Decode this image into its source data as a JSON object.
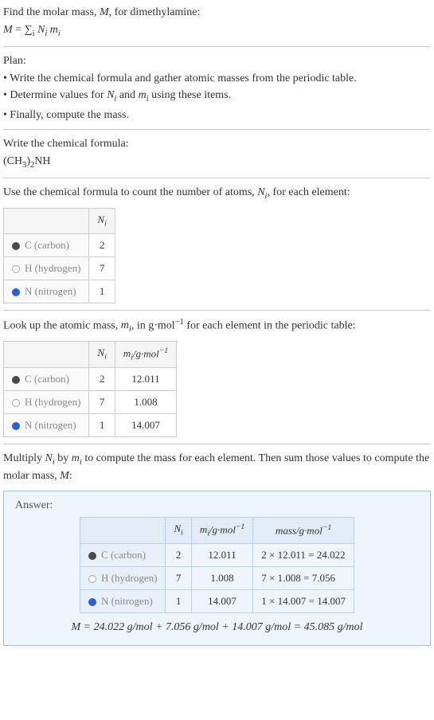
{
  "intro": {
    "line1": "Find the molar mass, M, for dimethylamine:",
    "formula": "M = Σᵢ Nᵢ mᵢ"
  },
  "plan": {
    "title": "Plan:",
    "b1": "• Write the chemical formula and gather atomic masses from the periodic table.",
    "b2": "• Determine values for Nᵢ and mᵢ using these items.",
    "b3": "• Finally, compute the mass."
  },
  "formula_section": {
    "line1": "Write the chemical formula:",
    "formula": "(CH₃)₂NH"
  },
  "count_section": {
    "intro": "Use the chemical formula to count the number of atoms, Nᵢ, for each element:",
    "header_ni": "Nᵢ",
    "rows": [
      {
        "dot": "carbon",
        "label": "C (carbon)",
        "n": "2"
      },
      {
        "dot": "hydrogen",
        "label": "H (hydrogen)",
        "n": "7"
      },
      {
        "dot": "nitrogen",
        "label": "N (nitrogen)",
        "n": "1"
      }
    ]
  },
  "mass_section": {
    "intro": "Look up the atomic mass, mᵢ, in g·mol⁻¹ for each element in the periodic table:",
    "header_ni": "Nᵢ",
    "header_mi": "mᵢ/g·mol⁻¹",
    "rows": [
      {
        "dot": "carbon",
        "label": "C (carbon)",
        "n": "2",
        "m": "12.011"
      },
      {
        "dot": "hydrogen",
        "label": "H (hydrogen)",
        "n": "7",
        "m": "1.008"
      },
      {
        "dot": "nitrogen",
        "label": "N (nitrogen)",
        "n": "1",
        "m": "14.007"
      }
    ]
  },
  "multiply_intro": "Multiply Nᵢ by mᵢ to compute the mass for each element. Then sum those values to compute the molar mass, M:",
  "answer": {
    "title": "Answer:",
    "header_ni": "Nᵢ",
    "header_mi": "mᵢ/g·mol⁻¹",
    "header_mass": "mass/g·mol⁻¹",
    "rows": [
      {
        "dot": "carbon",
        "label": "C (carbon)",
        "n": "2",
        "m": "12.011",
        "mass": "2 × 12.011 = 24.022"
      },
      {
        "dot": "hydrogen",
        "label": "H (hydrogen)",
        "n": "7",
        "m": "1.008",
        "mass": "7 × 1.008 = 7.056"
      },
      {
        "dot": "nitrogen",
        "label": "N (nitrogen)",
        "n": "1",
        "m": "14.007",
        "mass": "1 × 14.007 = 14.007"
      }
    ],
    "final": "M = 24.022 g/mol + 7.056 g/mol + 14.007 g/mol = 45.085 g/mol"
  }
}
